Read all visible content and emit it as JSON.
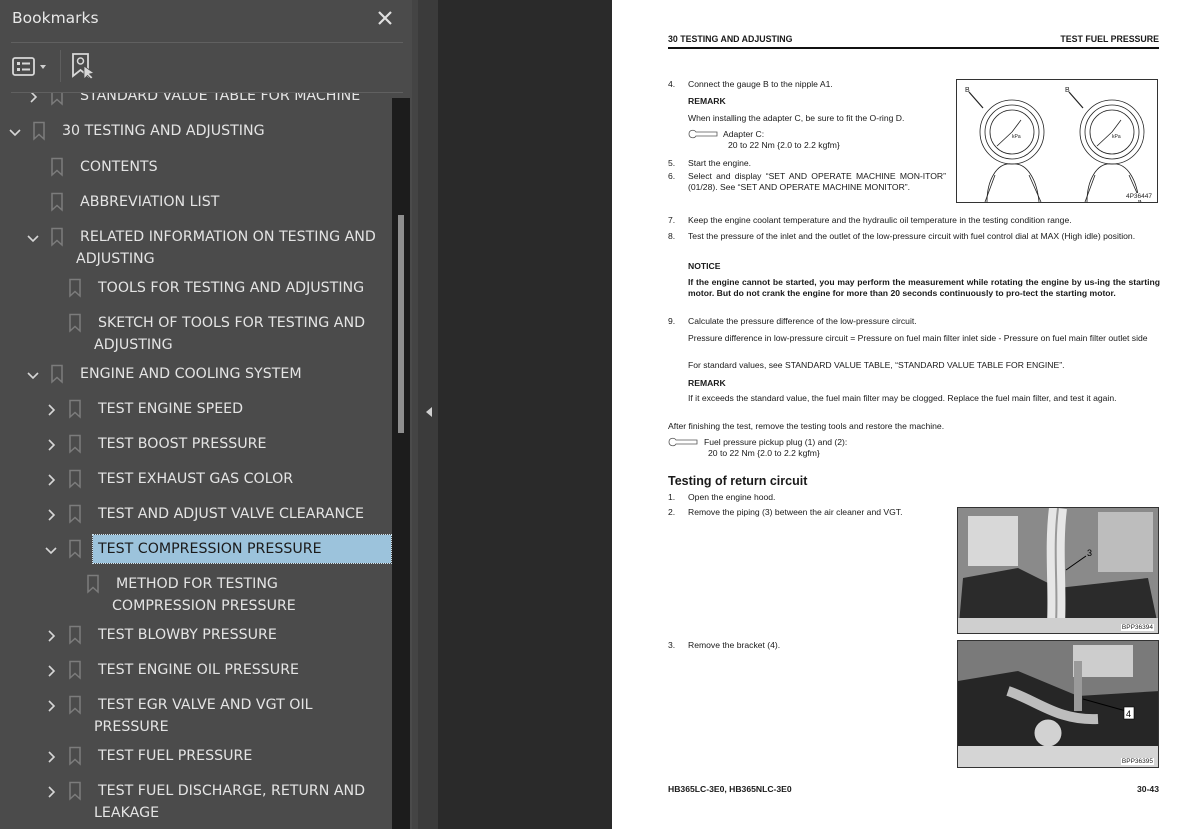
{
  "bookmarks_panel": {
    "title": "Bookmarks",
    "close_icon": "close-icon",
    "toolbar": {
      "options_icon": "list-options-icon",
      "find_icon": "find-current-bookmark-icon"
    },
    "items": [
      {
        "label": "STANDARD VALUE TABLE FOR MACHINE",
        "level": 1,
        "toggle": "collapsed",
        "partial": true
      },
      {
        "label": "30 TESTING AND ADJUSTING",
        "level": 0,
        "toggle": "expanded"
      },
      {
        "label": "CONTENTS",
        "level": 1,
        "toggle": "none"
      },
      {
        "label": "ABBREVIATION LIST",
        "level": 1,
        "toggle": "none"
      },
      {
        "label": "RELATED INFORMATION ON TESTING AND ADJUSTING",
        "level": 1,
        "toggle": "expanded"
      },
      {
        "label": "TOOLS FOR TESTING AND ADJUSTING",
        "level": 2,
        "toggle": "none"
      },
      {
        "label": "SKETCH OF TOOLS FOR TESTING AND ADJUSTING",
        "level": 2,
        "toggle": "none"
      },
      {
        "label": "ENGINE AND COOLING SYSTEM",
        "level": 1,
        "toggle": "expanded"
      },
      {
        "label": "TEST ENGINE SPEED",
        "level": 2,
        "toggle": "collapsed"
      },
      {
        "label": "TEST BOOST PRESSURE",
        "level": 2,
        "toggle": "collapsed"
      },
      {
        "label": "TEST EXHAUST GAS COLOR",
        "level": 2,
        "toggle": "collapsed"
      },
      {
        "label": "TEST AND ADJUST VALVE CLEARANCE",
        "level": 2,
        "toggle": "collapsed"
      },
      {
        "label": "TEST COMPRESSION PRESSURE",
        "level": 2,
        "toggle": "expanded",
        "selected": true
      },
      {
        "label": "METHOD FOR TESTING COMPRESSION PRESSURE",
        "level": 3,
        "toggle": "none"
      },
      {
        "label": "TEST BLOWBY PRESSURE",
        "level": 2,
        "toggle": "collapsed"
      },
      {
        "label": "TEST ENGINE OIL PRESSURE",
        "level": 2,
        "toggle": "collapsed"
      },
      {
        "label": "TEST EGR VALVE AND VGT OIL PRESSURE",
        "level": 2,
        "toggle": "collapsed"
      },
      {
        "label": "TEST FUEL PRESSURE",
        "level": 2,
        "toggle": "collapsed"
      },
      {
        "label": "TEST FUEL DISCHARGE, RETURN AND LEAKAGE",
        "level": 2,
        "toggle": "collapsed"
      }
    ],
    "colors": {
      "selected_bg": "#9cc3dc",
      "panel_bg": "#4b4b4b",
      "text": "#e4e4e4"
    }
  },
  "document": {
    "header_left": "30 TESTING AND ADJUSTING",
    "header_right": "TEST FUEL PRESSURE",
    "steps_a": [
      {
        "num": "4.",
        "text": "Connect the gauge B to the nipple A1."
      },
      {
        "num": "5.",
        "text": "Start the engine."
      },
      {
        "num": "6.",
        "text": "Select and display “SET AND OPERATE MACHINE MON-ITOR” (01/28). See “SET AND OPERATE MACHINE MONITOR”."
      },
      {
        "num": "7.",
        "text": "Keep the engine coolant temperature and the hydraulic oil temperature in the testing condition range."
      },
      {
        "num": "8.",
        "text": "Test the pressure of the inlet and the outlet of the low-pressure circuit with fuel control dial at MAX (High idle) position."
      },
      {
        "num": "9.",
        "text": "Calculate the pressure difference of the low-pressure circuit."
      }
    ],
    "remark_label": "REMARK",
    "remark1_text": "When installing the adapter C, be sure to fit the O-ring D.",
    "torque1_label": "Adapter C:",
    "torque1_value": "20 to 22 Nm {2.0 to 2.2 kgfm}",
    "notice_label": "NOTICE",
    "notice_text": "If the engine cannot be started, you may perform the measurement while rotating the engine by us-ing the starting motor. But do not crank the engine for more than 20 seconds continuously to pro-tect the starting motor.",
    "formula_text": "Pressure difference in low-pressure circuit = Pressure on fuel main filter inlet side - Pressure on fuel main filter outlet side",
    "standard_text": "For standard values, see STANDARD VALUE TABLE, “STANDARD VALUE TABLE FOR ENGINE”.",
    "remark2_text": "If it exceeds the standard value, the fuel main filter may be clogged. Replace the fuel main filter, and test it again.",
    "after_text": "After finishing the test, remove the testing tools and restore the machine.",
    "torque2_label": "Fuel pressure pickup plug (1) and (2):",
    "torque2_value": "20 to 22 Nm {2.0 to 2.2 kgfm}",
    "section_title": "Testing of return circuit",
    "steps_b": [
      {
        "num": "1.",
        "text": "Open the engine hood."
      },
      {
        "num": "2.",
        "text": "Remove the piping (3) between the air cleaner and VGT."
      },
      {
        "num": "3.",
        "text": "Remove the bracket (4)."
      }
    ],
    "figures": [
      {
        "code": "4P36447",
        "desc": "two pressure gauges B held in hands",
        "labels": [
          "B",
          "B"
        ]
      },
      {
        "code": "BPP36394",
        "desc": "engine compartment photo, piping (3)",
        "labels": [
          "3"
        ]
      },
      {
        "code": "BPP36395",
        "desc": "engine compartment photo, bracket (4)",
        "labels": [
          "4"
        ]
      }
    ],
    "footer_left": "HB365LC-3E0, HB365NLC-3E0",
    "footer_right": "30-43"
  }
}
